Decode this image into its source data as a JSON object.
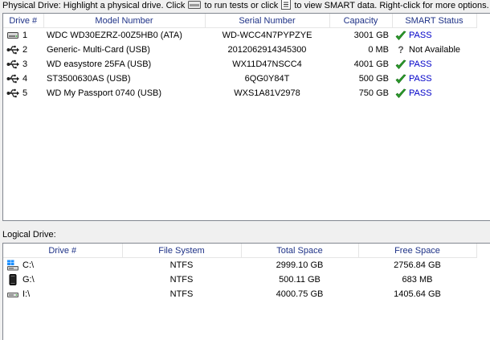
{
  "physical_caption": {
    "part1": "Physical Drive:   Highlight a physical drive. Click",
    "part2": "to run tests or click",
    "part3": "to view SMART data. Right-click for more options."
  },
  "physical_table": {
    "headers": [
      "Drive #",
      "Model Number",
      "Serial Number",
      "Capacity",
      "SMART Status"
    ],
    "rows": [
      {
        "icon": "internal-hdd-icon",
        "num": "1",
        "model": "WDC WD30EZRZ-00Z5HB0 (ATA)",
        "serial": "WD-WCC4N7PYPZYE",
        "capacity": "3001 GB",
        "status": "PASS",
        "status_icon": "green-check-icon"
      },
      {
        "icon": "usb-icon",
        "num": "2",
        "model": "Generic- Multi-Card (USB)",
        "serial": "2012062914345300",
        "capacity": "0 MB",
        "status": "Not Available",
        "status_icon": "question-mark-icon"
      },
      {
        "icon": "usb-icon",
        "num": "3",
        "model": "WD easystore 25FA (USB)",
        "serial": "WX11D47NSCC4",
        "capacity": "4001 GB",
        "status": "PASS",
        "status_icon": "green-check-icon"
      },
      {
        "icon": "usb-icon",
        "num": "4",
        "model": "ST3500630AS (USB)",
        "serial": "6QG0Y84T",
        "capacity": "500 GB",
        "status": "PASS",
        "status_icon": "green-check-icon"
      },
      {
        "icon": "usb-icon",
        "num": "5",
        "model": "WD My Passport 0740 (USB)",
        "serial": "WXS1A81V2978",
        "capacity": "750 GB",
        "status": "PASS",
        "status_icon": "green-check-icon"
      }
    ]
  },
  "logical_caption": "Logical Drive:",
  "logical_table": {
    "headers": [
      "Drive #",
      "File System",
      "Total Space",
      "Free Space"
    ],
    "rows": [
      {
        "icon": "windows-drive-icon",
        "drive": "C:\\",
        "fs": "NTFS",
        "total": "2999.10 GB",
        "free": "2756.84 GB"
      },
      {
        "icon": "external-drive-icon",
        "drive": "G:\\",
        "fs": "NTFS",
        "total": "500.11 GB",
        "free": "683 MB"
      },
      {
        "icon": "drive-icon",
        "drive": "I:\\",
        "fs": "NTFS",
        "total": "4000.75 GB",
        "free": "1405.64 GB"
      }
    ]
  },
  "colors": {
    "header_text": "#1e3287",
    "pass_text": "#0000c8",
    "check_green": "#2e9e2e"
  }
}
